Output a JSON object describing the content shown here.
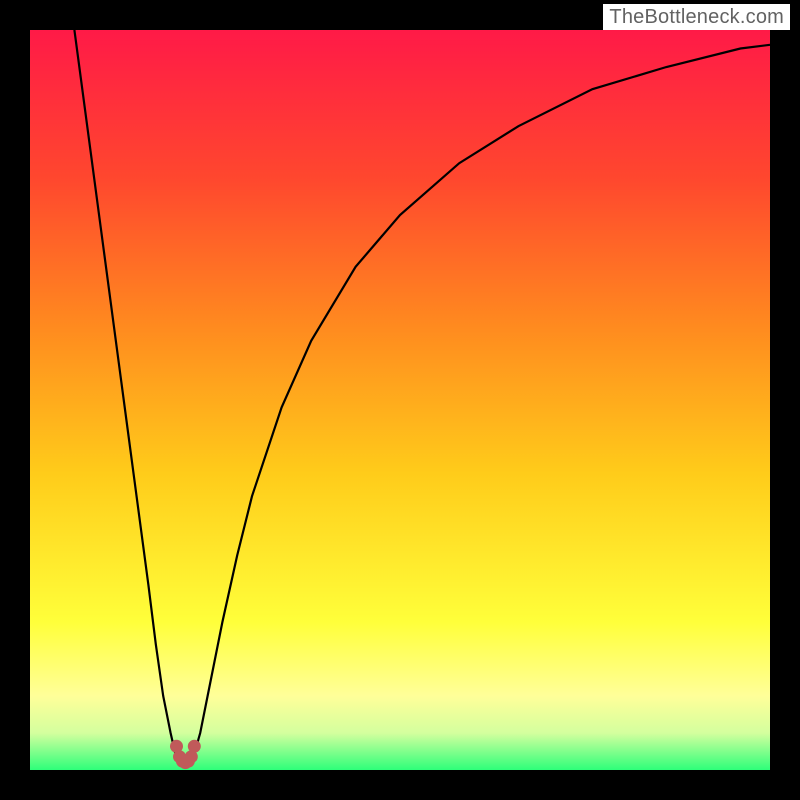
{
  "watermark": "TheBottleneck.com",
  "chart_data": {
    "type": "line",
    "title": "",
    "xlabel": "",
    "ylabel": "",
    "xlim": [
      0,
      100
    ],
    "ylim": [
      0,
      100
    ],
    "background_gradient": {
      "stops": [
        {
          "pos": 0.0,
          "color": "#ff1a47"
        },
        {
          "pos": 0.2,
          "color": "#ff472e"
        },
        {
          "pos": 0.4,
          "color": "#ff8a1f"
        },
        {
          "pos": 0.6,
          "color": "#ffcc1a"
        },
        {
          "pos": 0.8,
          "color": "#ffff3a"
        },
        {
          "pos": 0.9,
          "color": "#ffff99"
        },
        {
          "pos": 0.95,
          "color": "#d4ff9e"
        },
        {
          "pos": 1.0,
          "color": "#2eff7a"
        }
      ]
    },
    "series": [
      {
        "name": "bottleneck-curve",
        "type": "line",
        "color": "#000000",
        "x": [
          6,
          8,
          10,
          12,
          14,
          16,
          17,
          18,
          19,
          19.8,
          20.5,
          21,
          21.5,
          22,
          23,
          24,
          26,
          28,
          30,
          34,
          38,
          44,
          50,
          58,
          66,
          76,
          86,
          96,
          100
        ],
        "y": [
          100,
          85,
          70,
          55,
          40,
          25,
          17,
          10,
          5,
          1.5,
          1.0,
          0.8,
          1.0,
          1.5,
          5,
          10,
          20,
          29,
          37,
          49,
          58,
          68,
          75,
          82,
          87,
          92,
          95,
          97.5,
          98
        ]
      },
      {
        "name": "minimum-marker",
        "type": "points",
        "color": "#c05a5a",
        "x": [
          19.8,
          20.2,
          20.6,
          21.0,
          21.4,
          21.8,
          22.2
        ],
        "y": [
          3.2,
          1.8,
          1.2,
          1.0,
          1.2,
          1.8,
          3.2
        ]
      }
    ],
    "minimum": {
      "x": 21,
      "y": 0.8
    }
  }
}
